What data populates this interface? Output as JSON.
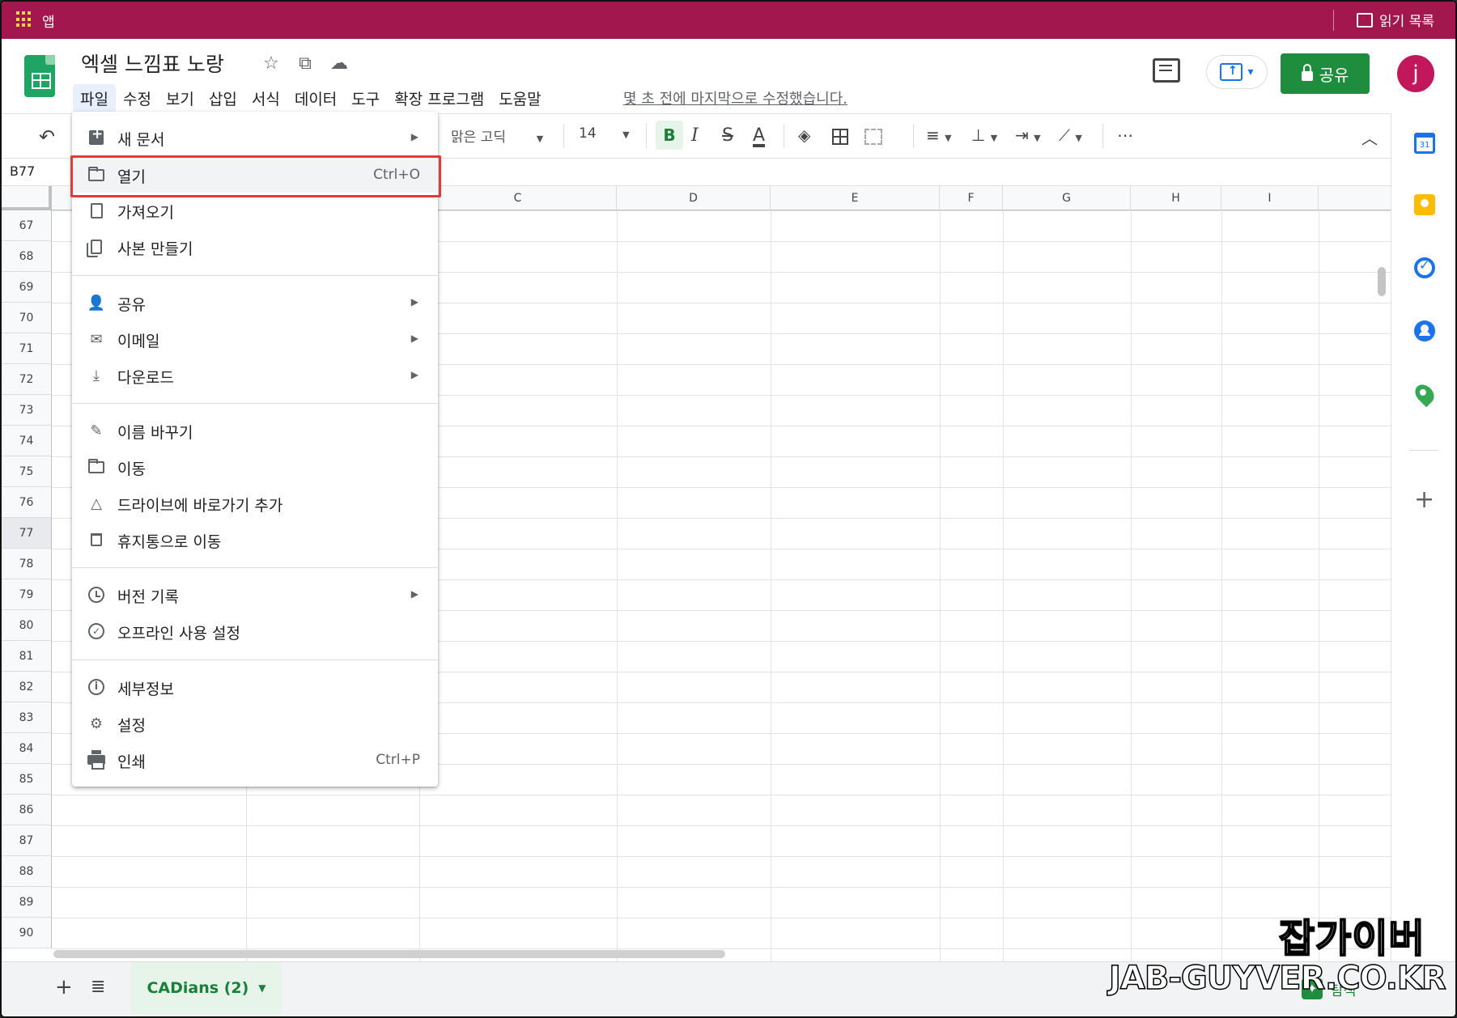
{
  "browser": {
    "apps_label": "앱",
    "reading_list_label": "읽기 목록"
  },
  "header": {
    "doc_title": "엑셀 느낌표 노랑",
    "menus": [
      "파일",
      "수정",
      "보기",
      "삽입",
      "서식",
      "데이터",
      "도구",
      "확장 프로그램",
      "도움말"
    ],
    "last_edit": "몇 초 전에 마지막으로 수정했습니다.",
    "share_label": "공유",
    "avatar_initial": "j"
  },
  "toolbar": {
    "font_name": "맑은 고딕",
    "font_size": "14",
    "bold_label": "B",
    "italic_label": "I",
    "strike_label": "S",
    "text_color_label": "A",
    "more_label": "⋯"
  },
  "formula_bar": {
    "name_box": "B77"
  },
  "grid": {
    "columns": [
      "C",
      "D",
      "E",
      "F",
      "G",
      "H",
      "I"
    ],
    "rows": [
      "67",
      "68",
      "69",
      "70",
      "71",
      "72",
      "73",
      "74",
      "75",
      "76",
      "77",
      "78",
      "79",
      "80",
      "81",
      "82",
      "83",
      "84",
      "85",
      "86",
      "87",
      "88",
      "89",
      "90"
    ],
    "selected_row": "77"
  },
  "file_menu": {
    "items": [
      {
        "label": "새 문서",
        "icon": "new-document-icon",
        "submenu": true
      },
      {
        "label": "열기",
        "icon": "folder-icon",
        "shortcut": "Ctrl+O"
      },
      {
        "label": "가져오기",
        "icon": "file-icon"
      },
      {
        "label": "사본 만들기",
        "icon": "copy-icon"
      },
      {
        "label": "공유",
        "icon": "person-add-icon",
        "submenu": true
      },
      {
        "label": "이메일",
        "icon": "email-icon",
        "submenu": true
      },
      {
        "label": "다운로드",
        "icon": "download-icon",
        "submenu": true
      },
      {
        "label": "이름 바꾸기",
        "icon": "rename-icon"
      },
      {
        "label": "이동",
        "icon": "move-folder-icon"
      },
      {
        "label": "드라이브에 바로가기 추가",
        "icon": "drive-shortcut-icon"
      },
      {
        "label": "휴지통으로 이동",
        "icon": "trash-icon"
      },
      {
        "label": "버전 기록",
        "icon": "history-icon",
        "submenu": true
      },
      {
        "label": "오프라인 사용 설정",
        "icon": "offline-icon"
      },
      {
        "label": "세부정보",
        "icon": "info-icon"
      },
      {
        "label": "설정",
        "icon": "settings-icon"
      },
      {
        "label": "인쇄",
        "icon": "printer-icon",
        "shortcut": "Ctrl+P"
      }
    ],
    "highlighted": "열기"
  },
  "sheets": {
    "active_tab": "CADians (2)",
    "explore_label": "탐색"
  },
  "watermark": {
    "korean": "잡가이버",
    "url": "JAB-GUYVER.CO.KR"
  },
  "colors": {
    "bookmarks_bar": "#a3174f",
    "share_button": "#1e8e3e",
    "highlight_box": "#e53935",
    "avatar": "#c2185b"
  }
}
